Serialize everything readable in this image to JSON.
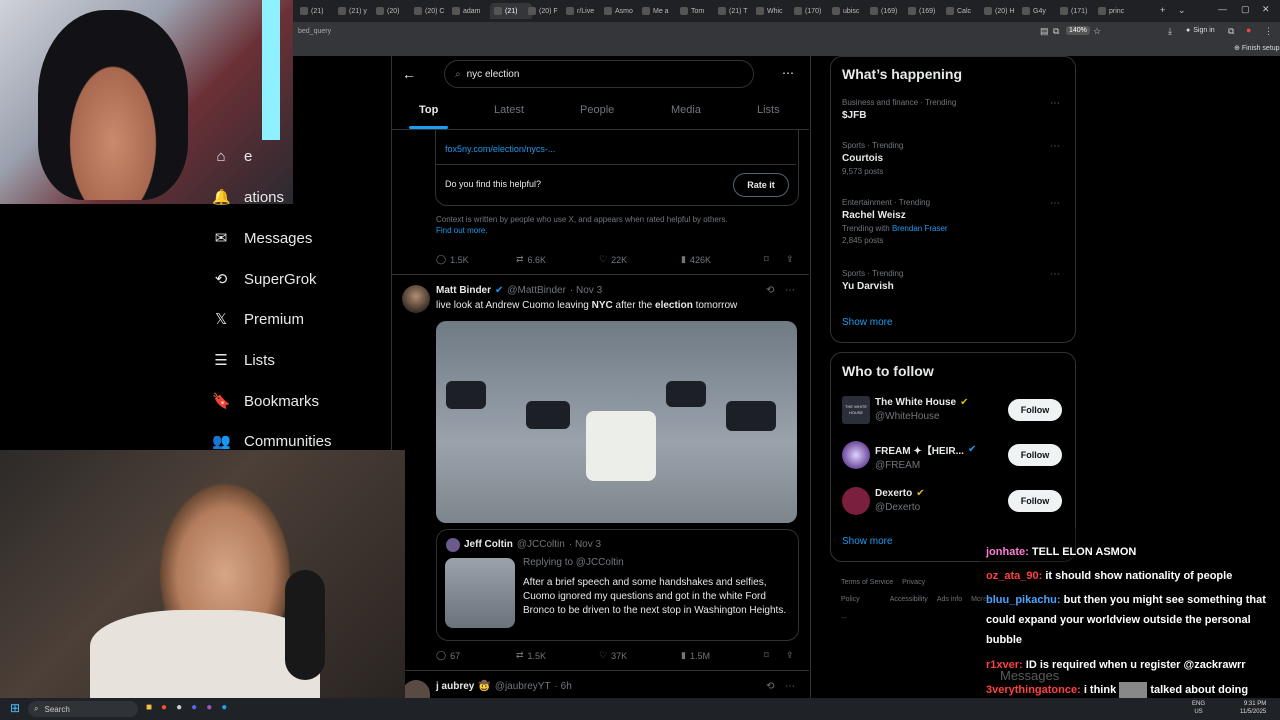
{
  "browser": {
    "tabs": [
      "(21)",
      "(21) y",
      "(20)",
      "(20) C",
      "adam",
      "(21)",
      "(20) F",
      "r/Live",
      "Asmo",
      "Me a",
      "Tom",
      "(21) T",
      "Whic",
      "(170)",
      "ubisc",
      "(169)",
      "(169)",
      "Calc",
      "(20) H",
      "G4y",
      "(171)",
      "princ"
    ],
    "url": "bed_query",
    "zoom": "140%",
    "sign_in": "Sign in",
    "finish_setup": "Finish setup"
  },
  "nav": {
    "items": [
      {
        "label": "e",
        "icon": "home-icon"
      },
      {
        "label": "ations",
        "icon": "bell-icon"
      },
      {
        "label": "Messages",
        "icon": "mail-icon"
      },
      {
        "label": "SuperGrok",
        "icon": "grok-icon"
      },
      {
        "label": "Premium",
        "icon": "x-icon"
      },
      {
        "label": "Lists",
        "icon": "list-icon"
      },
      {
        "label": "Bookmarks",
        "icon": "bookmark-icon"
      },
      {
        "label": "Communities",
        "icon": "people-icon"
      }
    ]
  },
  "search": {
    "value": "nyc election"
  },
  "tabs": [
    "Top",
    "Latest",
    "People",
    "Media",
    "Lists"
  ],
  "community_note": {
    "link": "fox5ny.com/election/nycs-...",
    "question": "Do you find this helpful?",
    "rate_label": "Rate it",
    "footer": "Context is written by people who use X, and appears when rated helpful by others.",
    "find_out_more": "Find out more."
  },
  "post1_actions": {
    "replies": "1.5K",
    "reposts": "6.6K",
    "likes": "22K",
    "views": "426K"
  },
  "post2": {
    "name": "Matt Binder",
    "handle": "@MattBinder",
    "date": "· Nov 3",
    "text_parts": [
      "live look at Andrew Cuomo leaving ",
      "NYC",
      " after the ",
      "election",
      " tomorrow"
    ],
    "quote": {
      "name": "Jeff Coltin",
      "handle": "@JCColtin",
      "date": "· Nov 3",
      "replying": "Replying to @JCColtin",
      "text": "After a brief speech and some handshakes and selfies, Cuomo ignored my questions and got in the white Ford Bronco to be driven to the next stop in Washington Heights."
    },
    "actions": {
      "replies": "67",
      "reposts": "1.5K",
      "likes": "37K",
      "views": "1.5M"
    }
  },
  "post3": {
    "name": "j aubrey",
    "emoji": "🤠",
    "handle": "@jaubreyYT",
    "date": "· 6h"
  },
  "happening": {
    "title": "What’s happening",
    "trends": [
      {
        "meta": "Business and finance · Trending",
        "name": "$JFB",
        "posts": ""
      },
      {
        "meta": "Sports · Trending",
        "name": "Courtois",
        "posts": "9,573 posts"
      },
      {
        "meta": "Entertainment · Trending",
        "name": "Rachel Weisz",
        "posts": "2,845 posts",
        "with_prefix": "Trending with",
        "with": "Brendan Fraser"
      },
      {
        "meta": "Sports · Trending",
        "name": "Yu Darvish",
        "posts": ""
      }
    ],
    "show_more": "Show more"
  },
  "who_to_follow": {
    "title": "Who to follow",
    "accounts": [
      {
        "name": "The White House",
        "handle": "@WhiteHouse",
        "avatar_text": "THE WHITE HOUSE"
      },
      {
        "name": "FREAM ✦【HEIR...",
        "handle": "@FREAM",
        "avatar_text": ""
      },
      {
        "name": "Dexerto",
        "handle": "@Dexerto",
        "avatar_text": ""
      }
    ],
    "follow_label": "Follow",
    "show_more": "Show more"
  },
  "footer_links": [
    "Terms of Service",
    "Privacy Policy",
    "Accessibility",
    "Ads info",
    "More ..."
  ],
  "chat": [
    {
      "user": "jonhate:",
      "msg": "TELL ELON ASMON",
      "color": "#ff7bd5"
    },
    {
      "user": "oz_ata_90:",
      "msg": "it should show nationality of people",
      "color": "#ff4040"
    },
    {
      "user": "bluu_pikachu:",
      "msg": "but then you might see something that could expand your worldview outside the personal bubble",
      "color": "#4aa3ff"
    },
    {
      "user": "r1xver:",
      "msg": "ID is required when u register @zackrawrr",
      "color": "#ff4040"
    },
    {
      "user": "3verythingatonce:",
      "msg": "i think",
      "color": "#ff4040",
      "tail": "talked about doing"
    }
  ],
  "chat_overlay": "Messages",
  "taskbar": {
    "search": "Search",
    "lang_top": "ENG",
    "lang_bottom": "US",
    "time": "9:31 PM",
    "date": "11/5/2025"
  },
  "colors": {
    "accent": "#1d9bf0",
    "border": "#2f3336",
    "muted": "#71767b"
  }
}
